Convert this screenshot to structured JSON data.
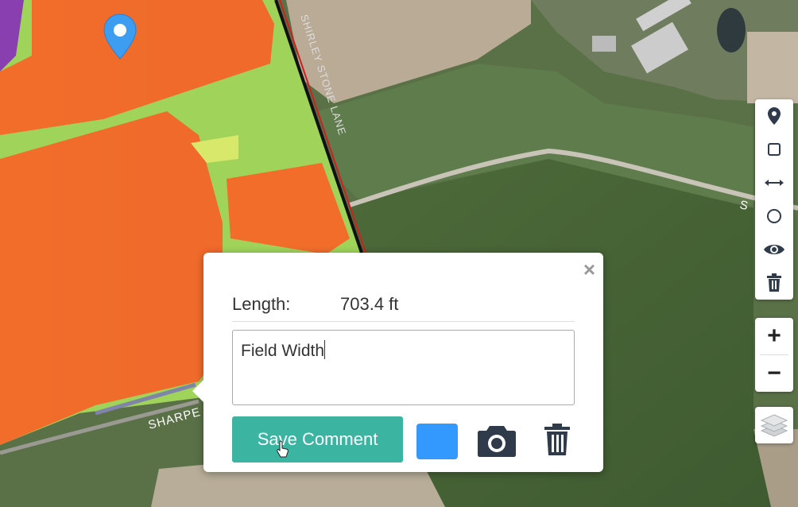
{
  "map": {
    "road_labels": [
      "SHARPE",
      "SHIRLEY STONE LANE",
      "S"
    ]
  },
  "popup": {
    "length_label": "Length:",
    "length_value": "703.4 ft",
    "comment_text": "Field Width",
    "save_button_label": "Save Comment",
    "color_swatch": "#3399ff",
    "close_symbol": "×"
  },
  "toolbar": {
    "tools": [
      "marker-icon",
      "rectangle-icon",
      "measure-distance-icon",
      "circle-icon",
      "eye-icon",
      "trash-icon"
    ]
  },
  "zoom": {
    "in_label": "+",
    "out_label": "−"
  },
  "layers_icon": "layers-icon",
  "colors": {
    "accent": "#3bb4a2",
    "pin": "#3d9df0",
    "field_orange": "#f26d2a",
    "icon_dark": "#2f3b4a"
  }
}
